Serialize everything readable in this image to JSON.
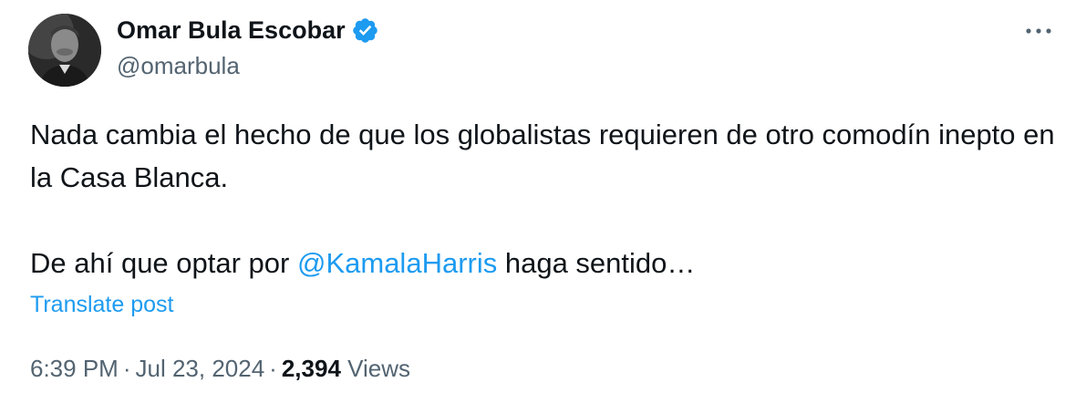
{
  "author": {
    "display_name": "Omar Bula Escobar",
    "handle": "@omarbula",
    "verified_icon": "verified-badge-icon",
    "avatar": "profile-photo-grayscale"
  },
  "more_icon": "more-horizontal-icon",
  "post": {
    "line1": "Nada cambia el hecho de que los globalistas requieren de otro comodín inepto en la Casa Blanca.",
    "line2_before": "De ahí que optar por ",
    "mention": "@KamalaHarris",
    "line2_after": " haga sentido…"
  },
  "translate_label": "Translate post",
  "meta": {
    "time": "6:39 PM",
    "separator": "·",
    "date": "Jul 23, 2024",
    "views_count": "2,394",
    "views_label": "Views"
  },
  "colors": {
    "text": "#0f1419",
    "secondary": "#536471",
    "link": "#1d9bf0",
    "verified": "#1d9bf0"
  }
}
